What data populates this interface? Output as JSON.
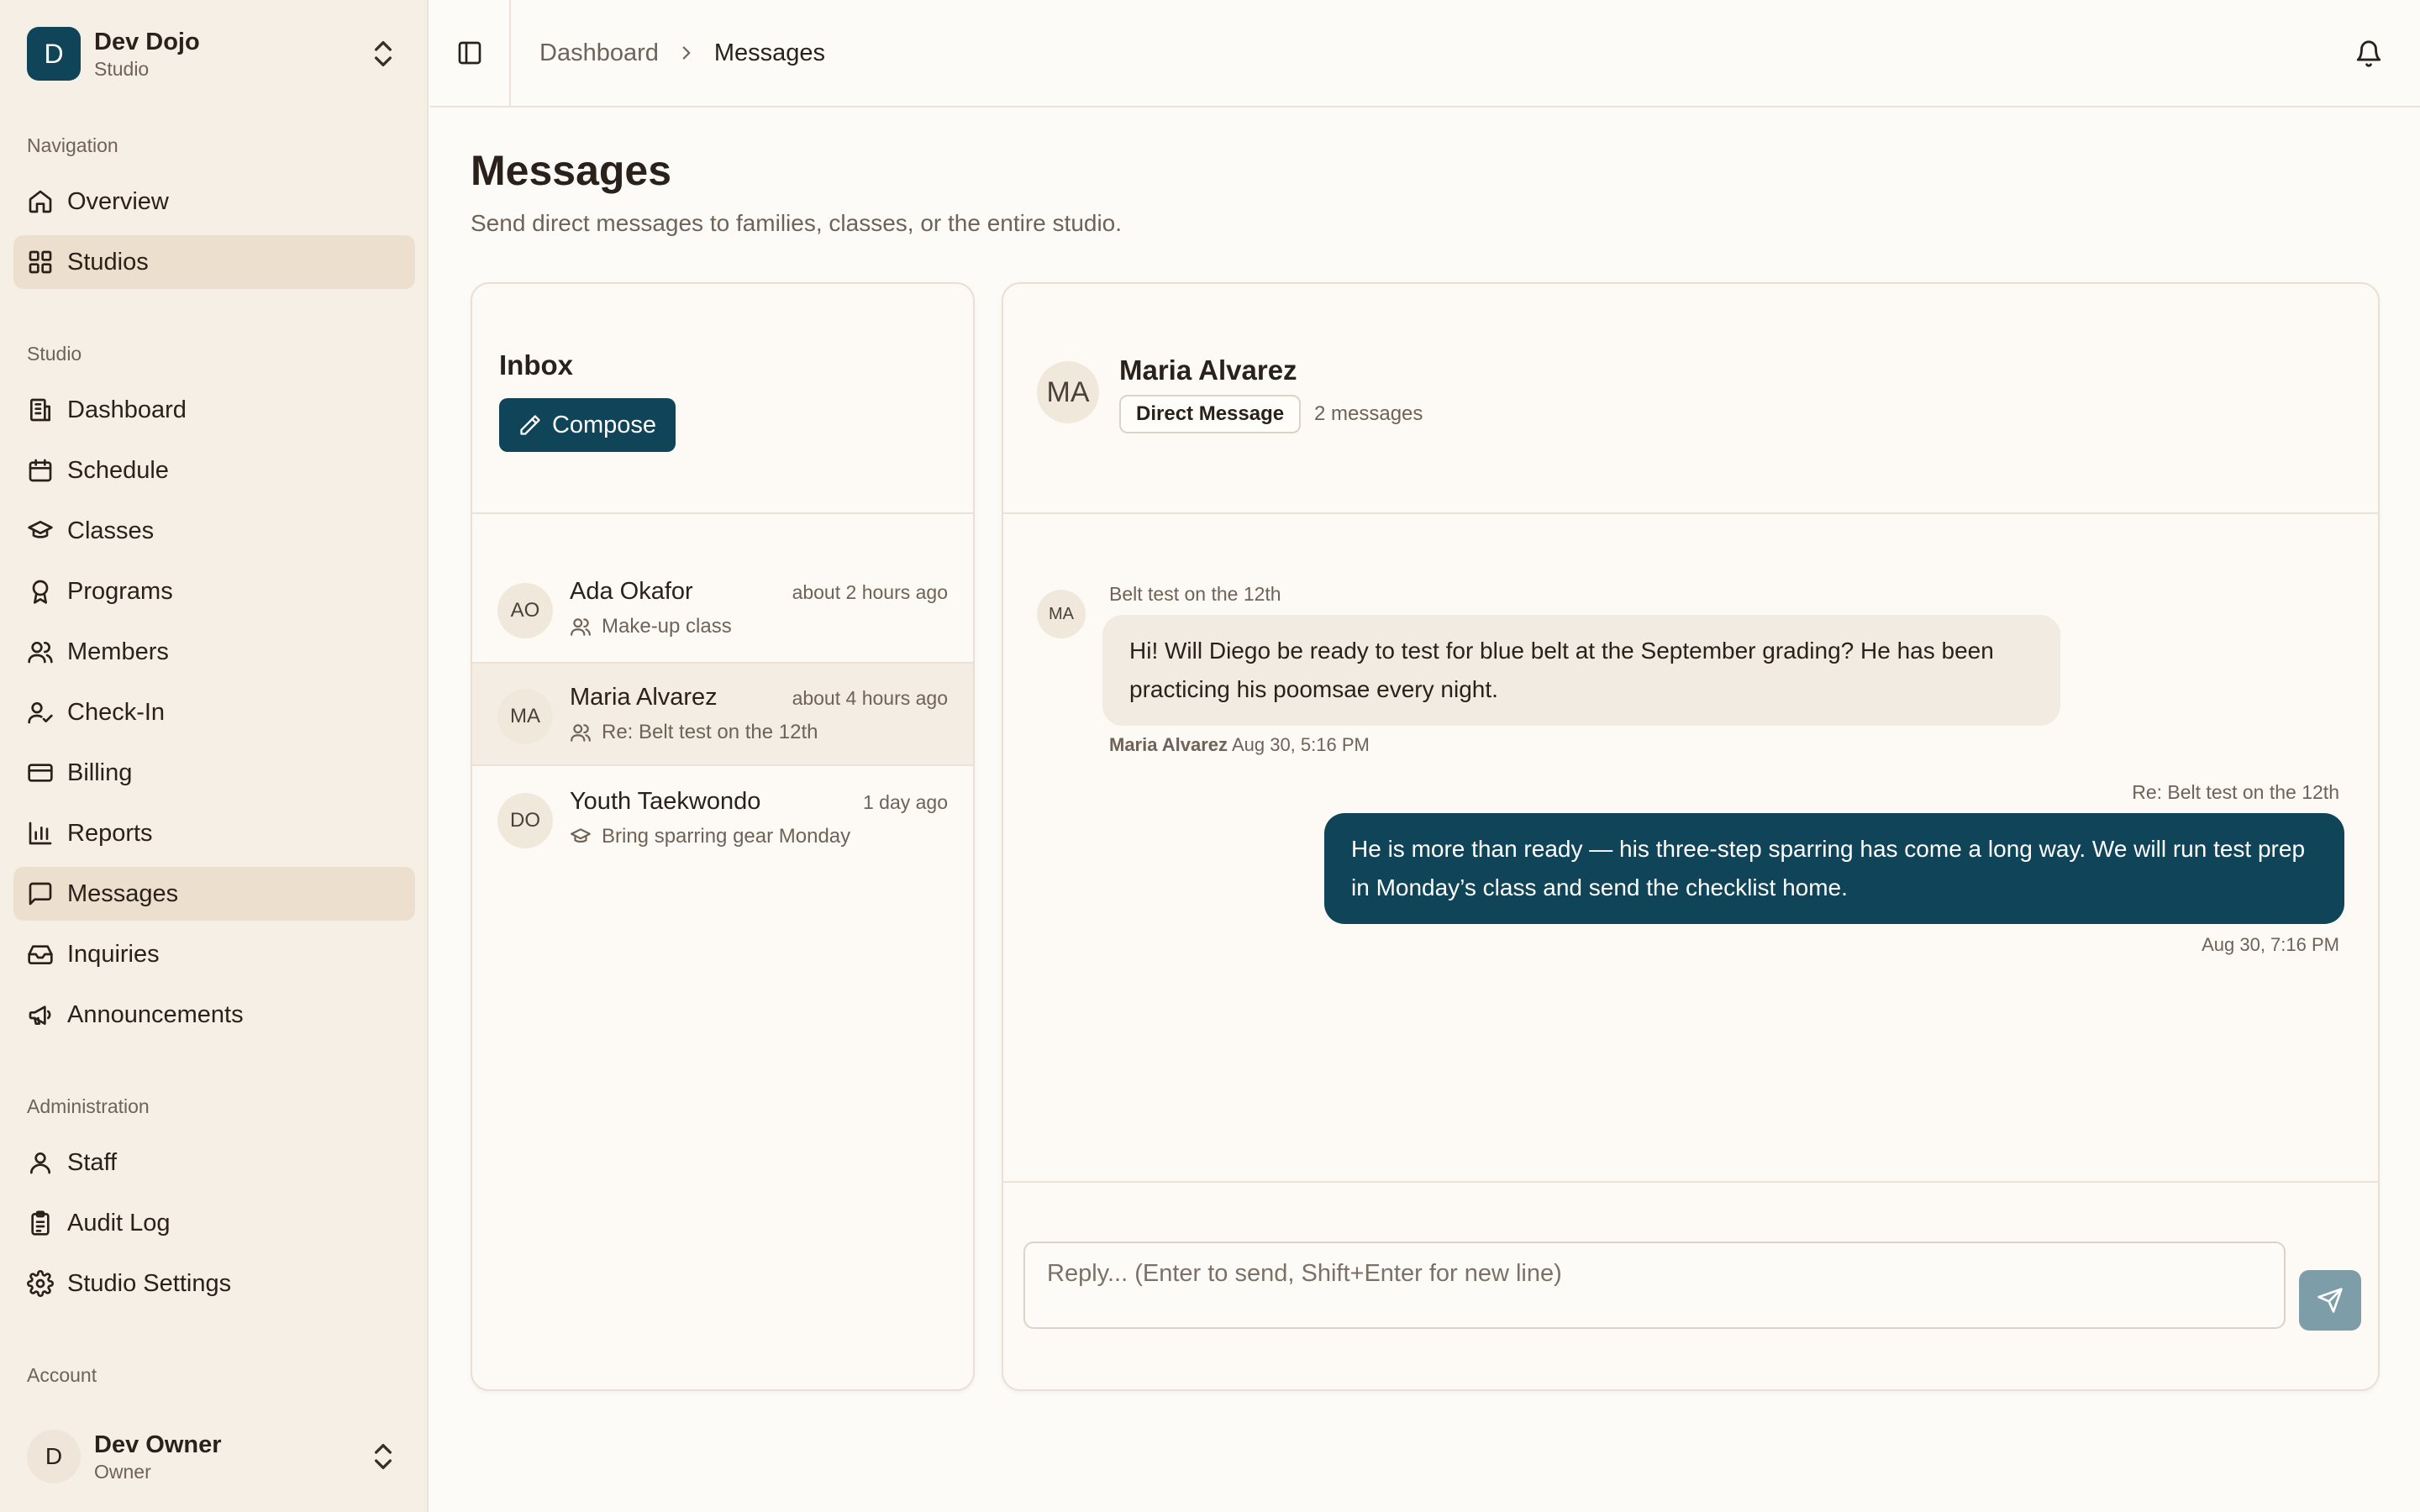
{
  "org": {
    "initial": "D",
    "name": "Dev Dojo",
    "subtitle": "Studio"
  },
  "sidebar": {
    "groups": [
      {
        "label": "Navigation",
        "items": [
          {
            "label": "Overview",
            "icon": "home-icon"
          },
          {
            "label": "Studios",
            "icon": "grid-icon",
            "active": true
          }
        ]
      },
      {
        "label": "Studio",
        "items": [
          {
            "label": "Dashboard",
            "icon": "building-icon"
          },
          {
            "label": "Schedule",
            "icon": "calendar-icon"
          },
          {
            "label": "Classes",
            "icon": "graduation-cap-icon"
          },
          {
            "label": "Programs",
            "icon": "award-icon"
          },
          {
            "label": "Members",
            "icon": "users-icon"
          },
          {
            "label": "Check-In",
            "icon": "user-check-icon"
          },
          {
            "label": "Billing",
            "icon": "wallet-icon"
          },
          {
            "label": "Reports",
            "icon": "bar-chart-icon"
          },
          {
            "label": "Messages",
            "icon": "message-square-icon",
            "active": true
          },
          {
            "label": "Inquiries",
            "icon": "inbox-icon"
          },
          {
            "label": "Announcements",
            "icon": "megaphone-icon"
          }
        ]
      },
      {
        "label": "Administration",
        "items": [
          {
            "label": "Staff",
            "icon": "user-icon"
          },
          {
            "label": "Audit Log",
            "icon": "clipboard-list-icon"
          },
          {
            "label": "Studio Settings",
            "icon": "gear-icon"
          }
        ]
      }
    ],
    "account_label": "Account"
  },
  "account": {
    "initial": "D",
    "name": "Dev Owner",
    "role": "Owner"
  },
  "breadcrumb": {
    "parent": "Dashboard",
    "current": "Messages"
  },
  "page": {
    "title": "Messages",
    "subtitle": "Send direct messages to families, classes, or the entire studio."
  },
  "inbox": {
    "title": "Inbox",
    "compose_label": "Compose",
    "conversations": [
      {
        "initials": "AO",
        "name": "Ada Okafor",
        "time": "about 2 hours ago",
        "preview": "Make-up class",
        "icon": "users-icon"
      },
      {
        "initials": "MA",
        "name": "Maria Alvarez",
        "time": "about 4 hours ago",
        "preview": "Re: Belt test on the 12th",
        "icon": "users-icon",
        "selected": true
      },
      {
        "initials": "DO",
        "name": "Youth Taekwondo",
        "time": "1 day ago",
        "preview": "Bring sparring gear Monday",
        "icon": "graduation-cap-icon"
      }
    ]
  },
  "thread": {
    "initials": "MA",
    "name": "Maria Alvarez",
    "badge": "Direct Message",
    "count": "2 messages",
    "messages": [
      {
        "direction": "in",
        "initials": "MA",
        "subject": "Belt test on the 12th",
        "body": "Hi! Will Diego be ready to test for blue belt at the September grading? He has been practicing his poomsae every night.",
        "author": "Maria Alvarez",
        "time": "Aug 30, 5:16 PM"
      },
      {
        "direction": "out",
        "subject": "Re: Belt test on the 12th",
        "body": "He is more than ready — his three-step sparring has come a long way. We will run test prep in Monday’s class and send the checklist home.",
        "time": "Aug 30, 7:16 PM"
      }
    ],
    "reply_placeholder": "Reply... (Enter to send, Shift+Enter for new line)"
  },
  "colors": {
    "accent": "#0f4459",
    "sidebar_bg": "#f6efe6",
    "active_item_bg": "#ecdfcd",
    "page_bg": "#fdfbf7",
    "send_button_disabled": "#7d9ea9"
  }
}
